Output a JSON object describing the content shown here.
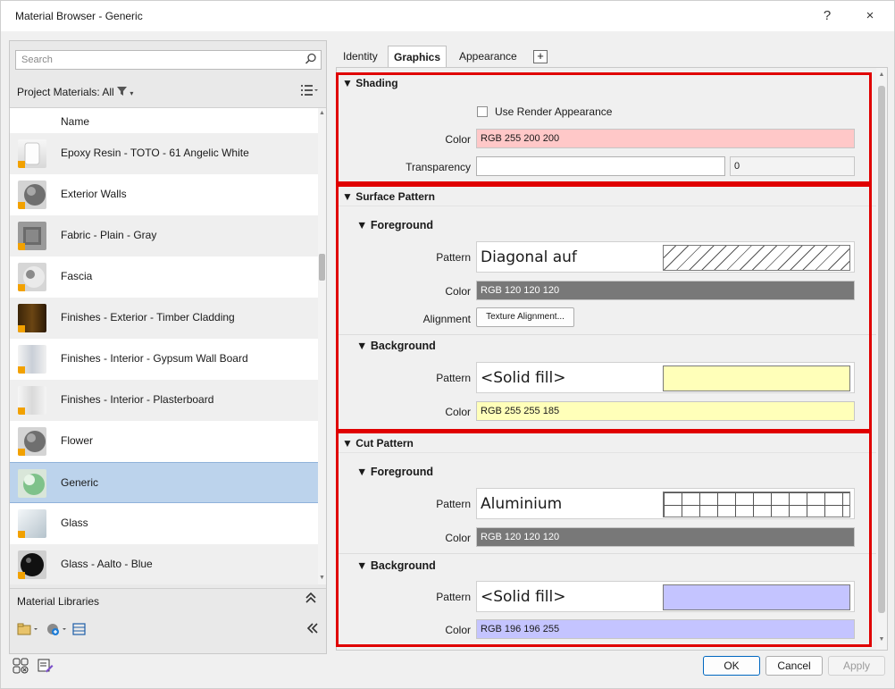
{
  "window": {
    "title": "Material Browser - Generic",
    "help": "?",
    "close": "×"
  },
  "search": {
    "placeholder": "Search"
  },
  "project_materials": {
    "label": "Project Materials: All"
  },
  "list": {
    "column_header": "Name",
    "items": [
      {
        "label": "Epoxy Resin - TOTO - 61 Angelic White",
        "icon": "white-vase-thumbnail"
      },
      {
        "label": "Exterior Walls",
        "icon": "gray-sphere-thumbnail"
      },
      {
        "label": "Fabric - Plain - Gray",
        "icon": "fabric-chair-thumbnail"
      },
      {
        "label": "Fascia",
        "icon": "light-sphere-thumbnail"
      },
      {
        "label": "Finishes - Exterior - Timber Cladding",
        "icon": "wood-thumbnail"
      },
      {
        "label": "Finishes - Interior - Gypsum Wall Board",
        "icon": "gypsum-wall-thumbnail"
      },
      {
        "label": "Finishes - Interior - Plasterboard",
        "icon": "plasterboard-thumbnail"
      },
      {
        "label": "Flower",
        "icon": "gray-sphere-thumbnail"
      },
      {
        "label": "Generic",
        "icon": "green-sphere-thumbnail",
        "selected": true
      },
      {
        "label": "Glass",
        "icon": "glass-thumbnail"
      },
      {
        "label": "Glass - Aalto - Blue",
        "icon": "black-sphere-thumbnail"
      }
    ]
  },
  "libraries": {
    "label": "Material Libraries"
  },
  "tabs": [
    "Identity",
    "Graphics",
    "Appearance"
  ],
  "tab_plus": "+",
  "shading": {
    "title": "▼ Shading",
    "use_render_label": "Use Render Appearance",
    "color_label": "Color",
    "color_value": "RGB 255 200 200",
    "color_hex": "#ffc8c8",
    "transparency_label": "Transparency",
    "transparency_value": "0"
  },
  "surface": {
    "title": "▼ Surface Pattern",
    "foreground": {
      "title": "▼ Foreground",
      "pattern_label": "Pattern",
      "pattern_name": "Diagonal auf",
      "color_label": "Color",
      "color_value": "RGB 120 120 120",
      "color_hex": "#787878",
      "alignment_label": "Alignment",
      "alignment_button": "Texture Alignment..."
    },
    "background": {
      "title": "▼ Background",
      "pattern_label": "Pattern",
      "pattern_name": "<Solid fill>",
      "color_label": "Color",
      "color_value": "RGB 255 255 185",
      "color_hex": "#ffffb9"
    }
  },
  "cut": {
    "title": "▼ Cut Pattern",
    "foreground": {
      "title": "▼ Foreground",
      "pattern_label": "Pattern",
      "pattern_name": "Aluminium",
      "color_label": "Color",
      "color_value": "RGB 120 120 120",
      "color_hex": "#787878"
    },
    "background": {
      "title": "▼ Background",
      "pattern_label": "Pattern",
      "pattern_name": "<Solid fill>",
      "color_label": "Color",
      "color_value": "RGB 196 196 255",
      "color_hex": "#c4c4ff"
    }
  },
  "buttons": {
    "ok": "OK",
    "cancel": "Cancel",
    "apply": "Apply"
  }
}
